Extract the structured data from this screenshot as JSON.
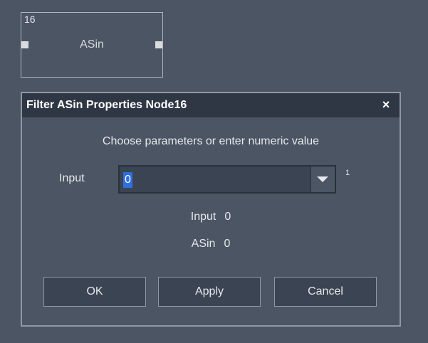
{
  "node": {
    "id": "16",
    "label": "ASin"
  },
  "dialog": {
    "title": "Filter ASin Properties Node16",
    "close_label": "×",
    "instruction": "Choose parameters or enter numeric value",
    "input": {
      "label": "Input",
      "value": "0",
      "superscript": "1"
    },
    "info": [
      {
        "key": "Input",
        "value": "0"
      },
      {
        "key": "ASin",
        "value": "0"
      }
    ],
    "buttons": {
      "ok": "OK",
      "apply": "Apply",
      "cancel": "Cancel"
    }
  },
  "colors": {
    "background": "#4b5563",
    "titlebar": "#2f3744",
    "selection": "#2f6fe0"
  }
}
